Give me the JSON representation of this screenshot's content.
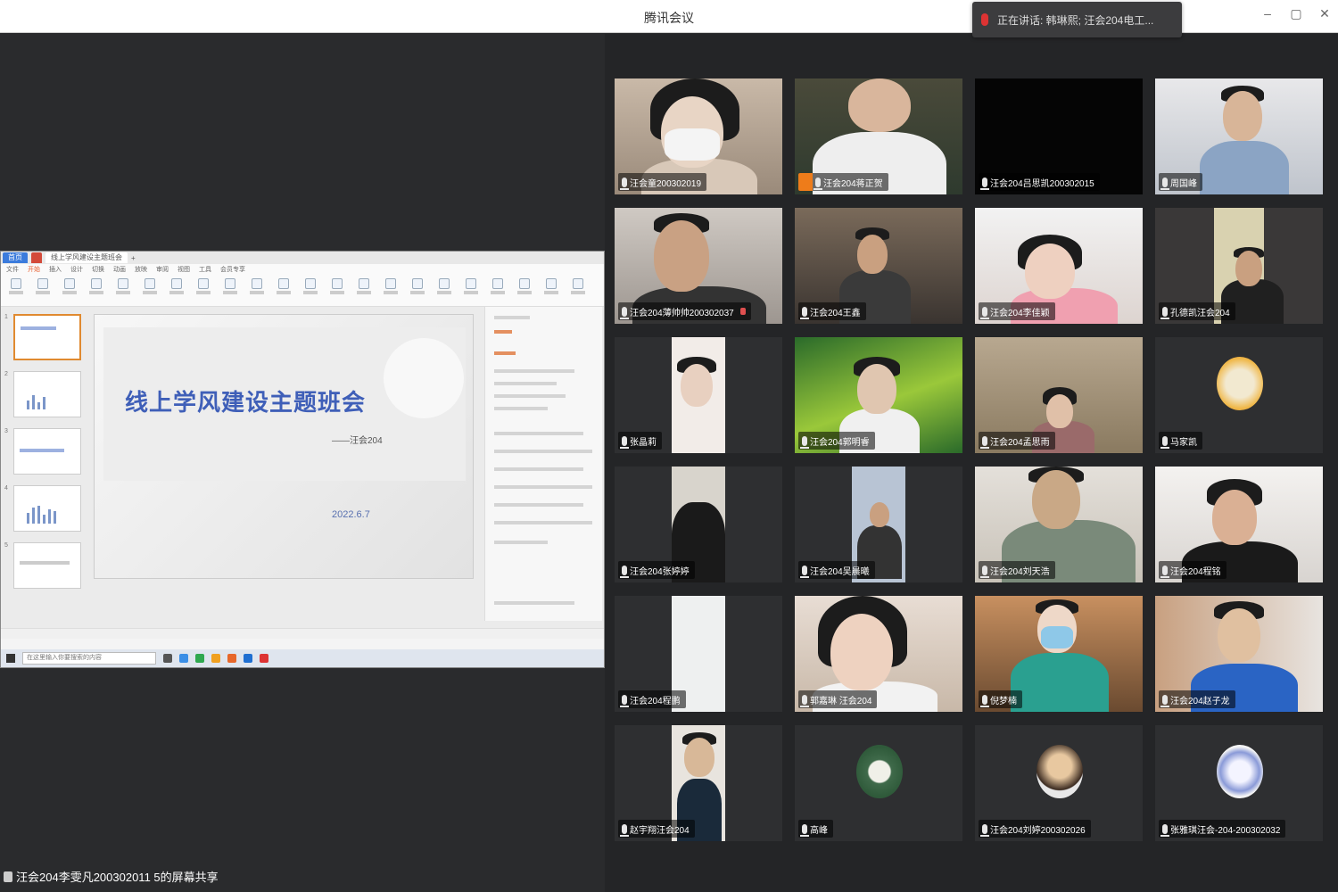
{
  "window": {
    "title": "腾讯会议"
  },
  "notification": {
    "text": "正在讲话: 韩琳熙; 汪会204电工..."
  },
  "shared_window": {
    "tabs": [
      "首页",
      "",
      "线上学风建设主题班会",
      "+"
    ],
    "menu": [
      "文件",
      "开始",
      "插入",
      "设计",
      "切换",
      "动画",
      "放映",
      "审阅",
      "视图",
      "工具",
      "会员专享"
    ],
    "slide": {
      "title": "线上学风建设主题班会",
      "subtitle": "——汪会204",
      "date": "2022.6.7"
    },
    "taskbar_search": "在这里输入你要搜索的内容"
  },
  "share_caption": "汪会204李雯凡200302011 5的屏幕共享",
  "participants": [
    {
      "name": "汪会童200302019",
      "scene": "mask-girl"
    },
    {
      "name": "汪会204蒋正贺",
      "scene": "girl-white",
      "host": true
    },
    {
      "name": "汪会204吕思凯200302015",
      "scene": "black"
    },
    {
      "name": "周国峰",
      "scene": "teacher"
    },
    {
      "name": "汪会204薄帅帅200302037",
      "scene": "boy-close",
      "live": true
    },
    {
      "name": "汪会204王鑫",
      "scene": "room-boy"
    },
    {
      "name": "汪会204李佳颖",
      "scene": "ceiling-girl"
    },
    {
      "name": "孔德凯汪会204",
      "scene": "wall-boy"
    },
    {
      "name": "张晶莉",
      "scene": "narrow-glasses"
    },
    {
      "name": "汪会204郭明睿",
      "scene": "leaf"
    },
    {
      "name": "汪会204孟思雨",
      "scene": "shelf-girl"
    },
    {
      "name": "马家凯",
      "scene": "avatar-orange"
    },
    {
      "name": "汪会204张婷婷",
      "scene": "narrow-dark"
    },
    {
      "name": "汪会204吴晨曦",
      "scene": "narrow-phone"
    },
    {
      "name": "汪会204刘天浩",
      "scene": "green-hoodie"
    },
    {
      "name": "汪会204程铭",
      "scene": "boy-wall"
    },
    {
      "name": "汪会204程鹏",
      "scene": "narrow-white"
    },
    {
      "name": "郭嘉琳 汪会204",
      "scene": "hand-girl"
    },
    {
      "name": "倪梦楠",
      "scene": "mask-green"
    },
    {
      "name": "汪会204赵子龙",
      "scene": "yellow-boy"
    },
    {
      "name": "赵宇翔汪会204",
      "scene": "narrow-guy"
    },
    {
      "name": "高峰",
      "scene": "avatar-seal"
    },
    {
      "name": "汪会204刘婷200302026",
      "scene": "avatar-girl"
    },
    {
      "name": "张雅琪汪会-204-200302032",
      "scene": "avatar-anime"
    }
  ]
}
